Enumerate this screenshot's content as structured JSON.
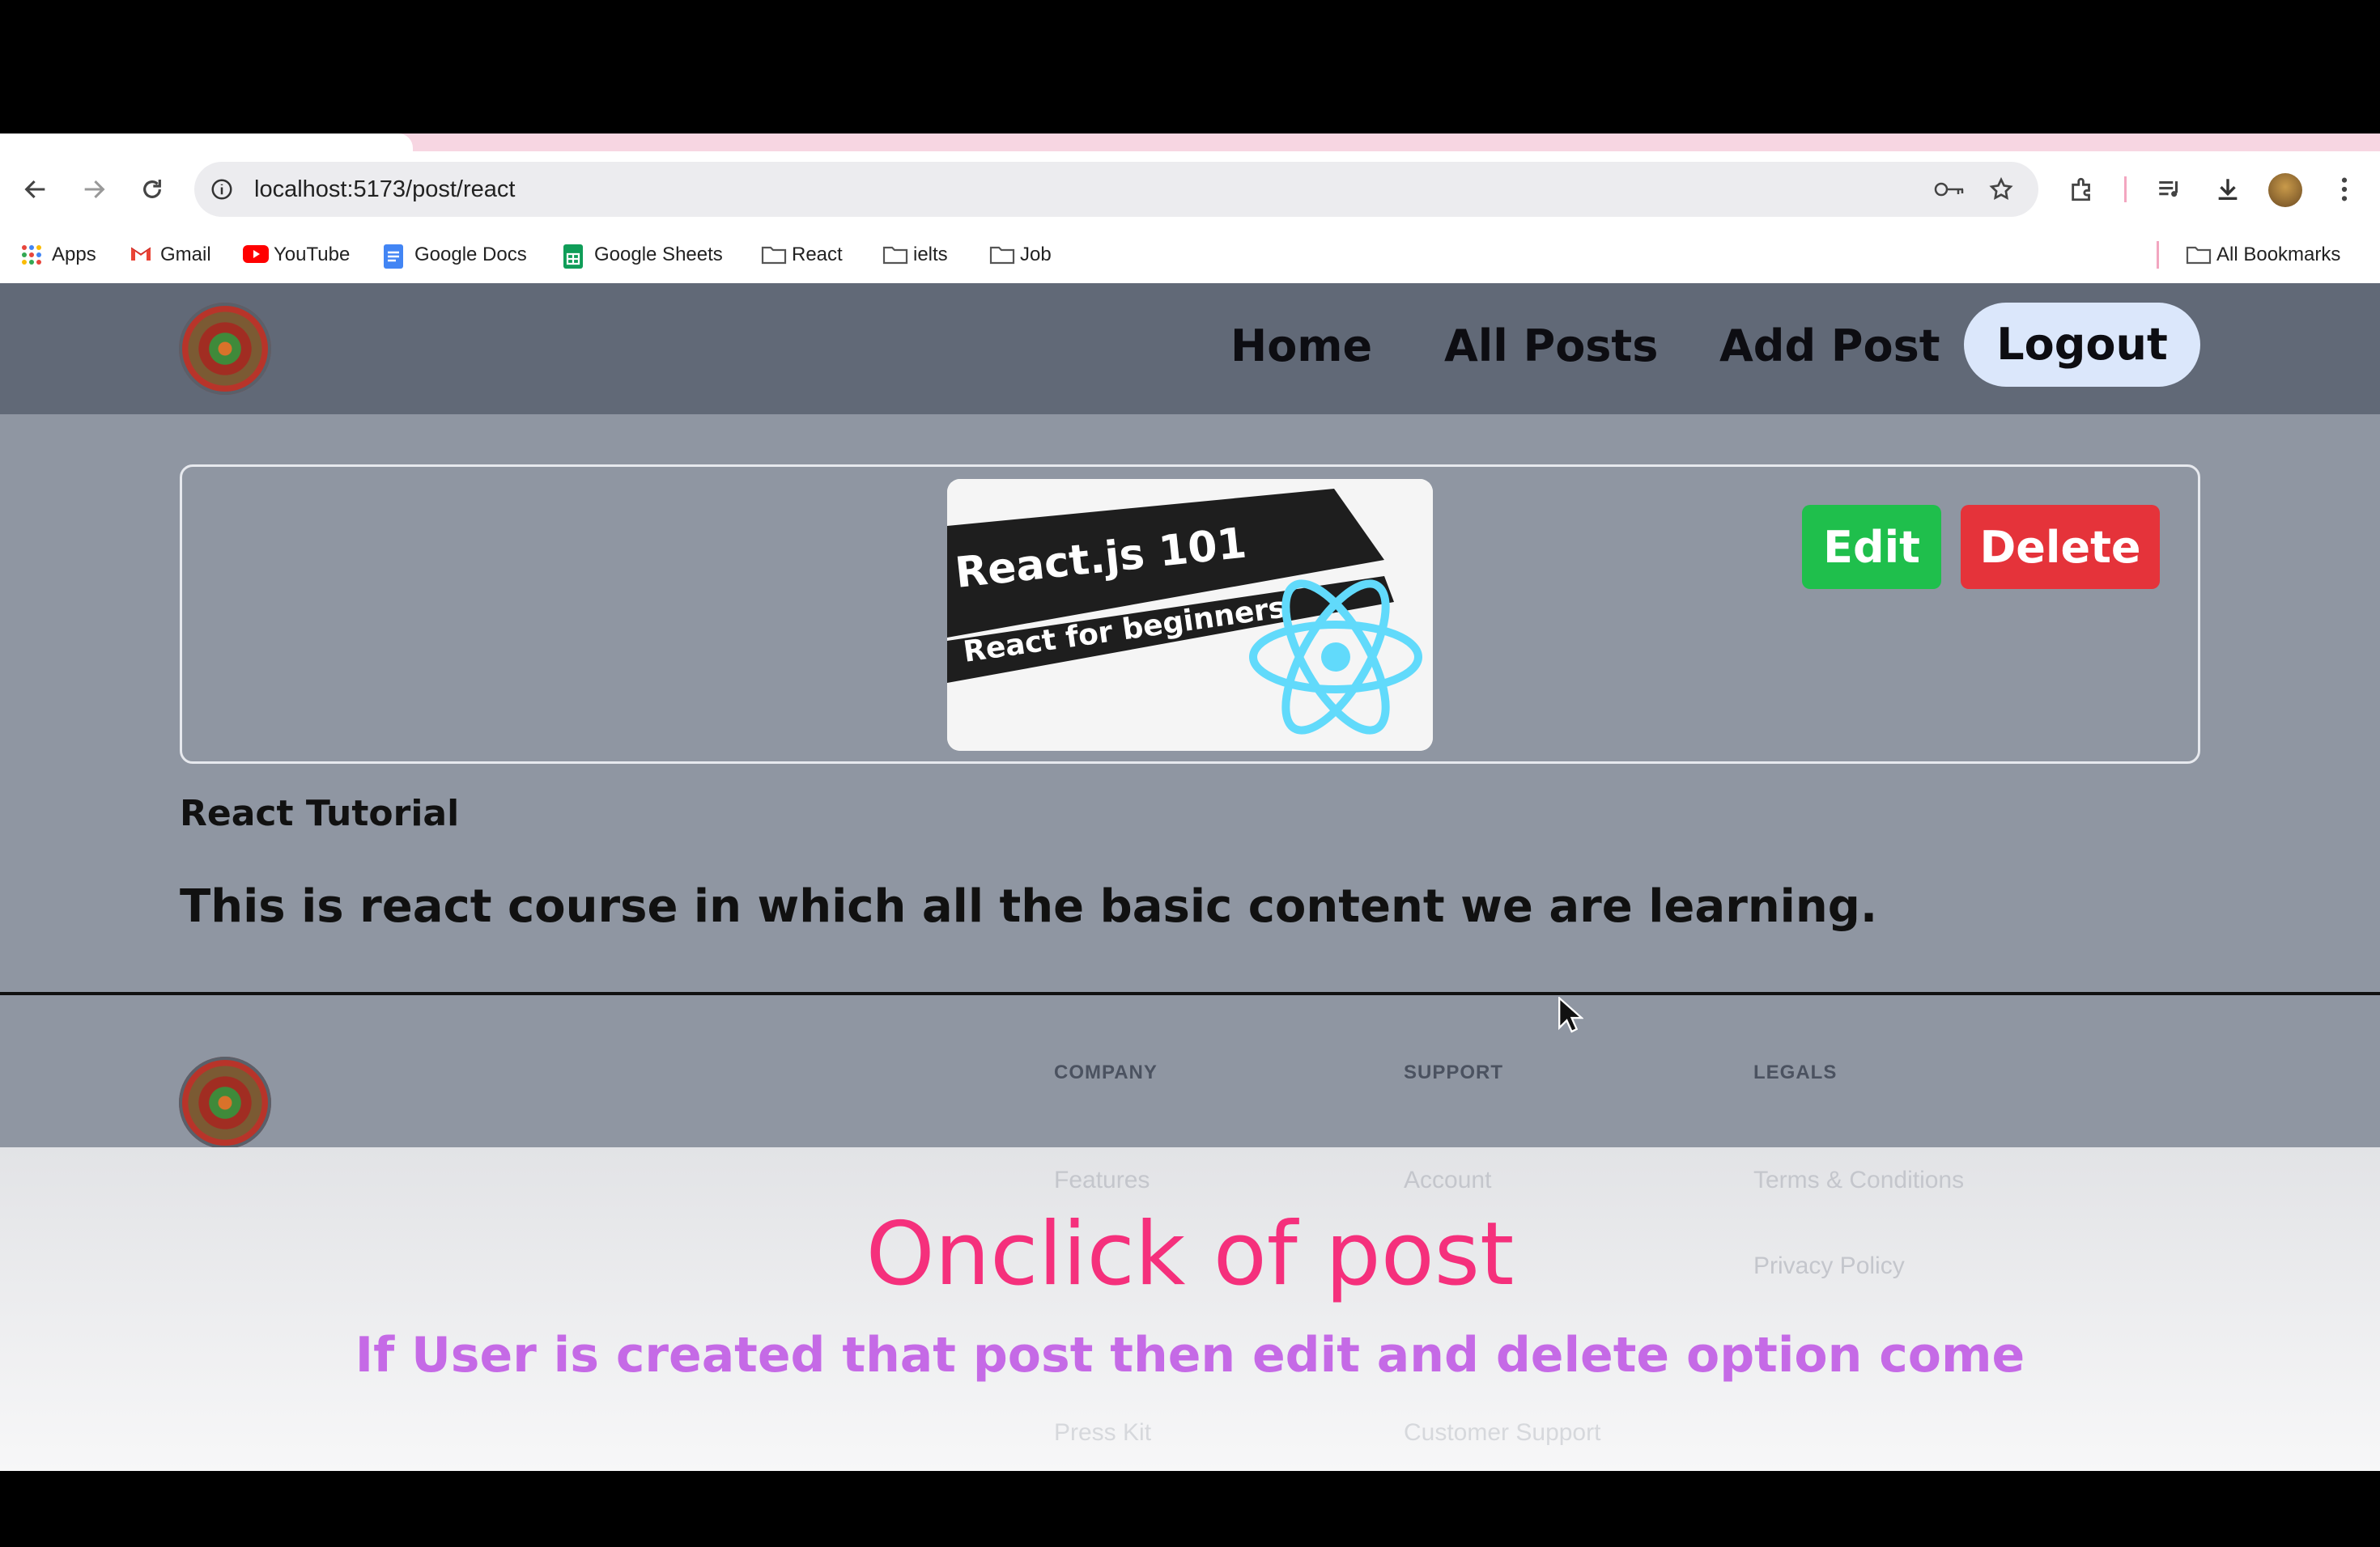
{
  "browser": {
    "url": "localhost:5173/post/react",
    "bookmarks": [
      {
        "label": "Apps",
        "icon": "apps-grid-icon"
      },
      {
        "label": "Gmail",
        "icon": "gmail-icon"
      },
      {
        "label": "YouTube",
        "icon": "youtube-icon"
      },
      {
        "label": "Google Docs",
        "icon": "google-docs-icon"
      },
      {
        "label": "Google Sheets",
        "icon": "google-sheets-icon"
      },
      {
        "label": "React",
        "icon": "folder-icon"
      },
      {
        "label": "ielts",
        "icon": "folder-icon"
      },
      {
        "label": "Job",
        "icon": "folder-icon"
      }
    ],
    "all_bookmarks": "All Bookmarks"
  },
  "header": {
    "nav": [
      "Home",
      "All Posts",
      "Add Post"
    ],
    "logout": "Logout"
  },
  "post": {
    "image_lines": [
      "React.js 101",
      "React for beginners"
    ],
    "edit_label": "Edit",
    "delete_label": "Delete",
    "title": "React Tutorial",
    "content": "This is react course in which all the basic content we are learning."
  },
  "footer": {
    "columns": [
      {
        "heading": "COMPANY",
        "links": [
          "Features",
          "Press Kit"
        ]
      },
      {
        "heading": "SUPPORT",
        "links": [
          "Account",
          "Customer Support"
        ]
      },
      {
        "heading": "LEGALS",
        "links": [
          "Terms & Conditions",
          "Privacy Policy"
        ]
      }
    ]
  },
  "caption": {
    "title": "Onclick of post",
    "subtitle": "If User is created that post then edit and delete option come"
  },
  "colors": {
    "header_bg": "#616977",
    "main_bg": "#8f96a2",
    "edit": "#1fbf4c",
    "delete": "#e5333a",
    "caption_title": "#f5307c",
    "caption_subtitle": "#c56ae6"
  }
}
